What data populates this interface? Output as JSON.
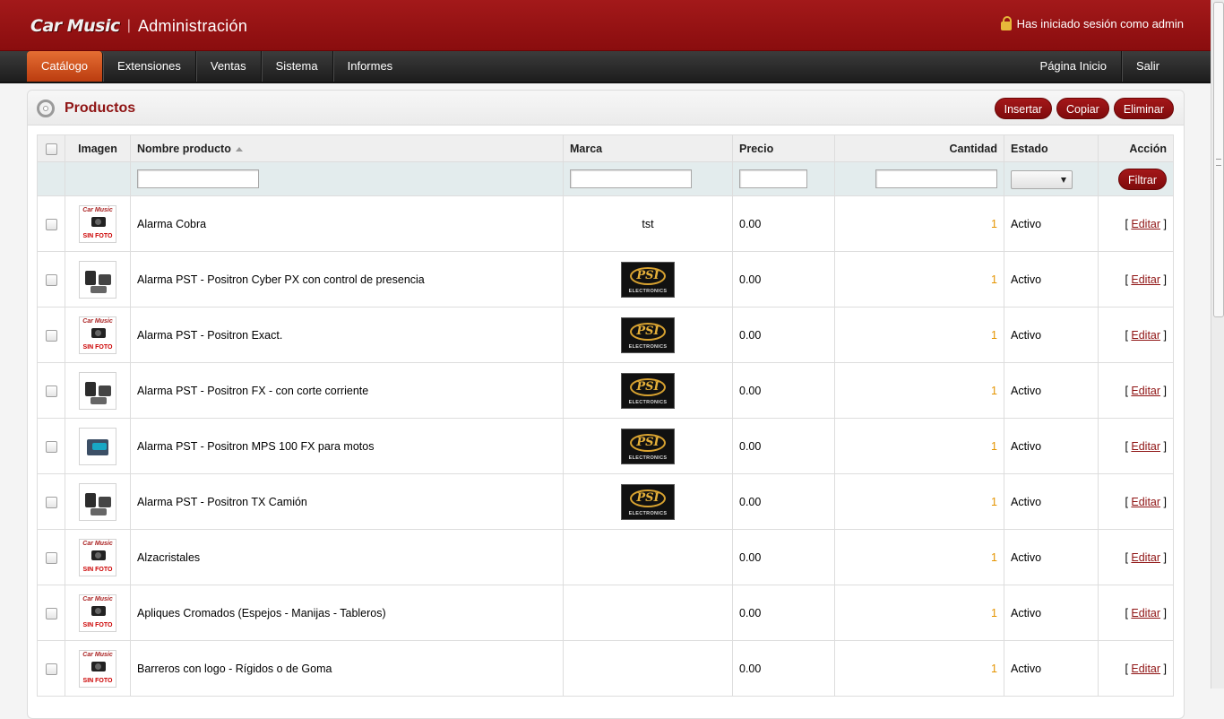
{
  "header": {
    "logo_text": "Car Music",
    "separator": "|",
    "title": "Administración",
    "login_text": "Has iniciado sesión como admin",
    "colors": {
      "header_bg": "#9a1314",
      "accent_orange": "#d85521",
      "title_red": "#8f1414"
    }
  },
  "menu": {
    "left": [
      "Catálogo",
      "Extensiones",
      "Ventas",
      "Sistema",
      "Informes"
    ],
    "active": "Catálogo",
    "right": [
      "Página Inicio",
      "Salir"
    ]
  },
  "panel": {
    "title": "Productos",
    "icon": "gear-icon",
    "buttons": {
      "insert": "Insertar",
      "copy": "Copiar",
      "delete": "Eliminar"
    }
  },
  "table": {
    "columns": {
      "image": "Imagen",
      "name": "Nombre producto",
      "brand": "Marca",
      "price": "Precio",
      "quantity": "Cantidad",
      "status": "Estado",
      "action": "Acción"
    },
    "filter": {
      "name": "",
      "brand": "",
      "price": "",
      "quantity": "",
      "status": "",
      "button": "Filtrar"
    },
    "rows": [
      {
        "image": "sin-foto",
        "name": "Alarma Cobra",
        "brand_text": "tst",
        "brand_logo": "",
        "price": "0.00",
        "quantity": "1",
        "status": "Activo",
        "action": "Editar"
      },
      {
        "image": "photo-remotes",
        "name": "Alarma PST - Positron Cyber PX con control de presencia",
        "brand_text": "",
        "brand_logo": "psi-electronics",
        "price": "0.00",
        "quantity": "1",
        "status": "Activo",
        "action": "Editar"
      },
      {
        "image": "sin-foto",
        "name": "Alarma PST - Positron Exact.",
        "brand_text": "",
        "brand_logo": "psi-electronics",
        "price": "0.00",
        "quantity": "1",
        "status": "Activo",
        "action": "Editar"
      },
      {
        "image": "photo-remotes",
        "name": "Alarma PST - Positron FX - con corte corriente",
        "brand_text": "",
        "brand_logo": "psi-electronics",
        "price": "0.00",
        "quantity": "1",
        "status": "Activo",
        "action": "Editar"
      },
      {
        "image": "photo-box",
        "name": "Alarma PST - Positron MPS 100 FX para motos",
        "brand_text": "",
        "brand_logo": "psi-electronics",
        "price": "0.00",
        "quantity": "1",
        "status": "Activo",
        "action": "Editar"
      },
      {
        "image": "photo-remotes",
        "name": "Alarma PST - Positron TX Camión",
        "brand_text": "",
        "brand_logo": "psi-electronics",
        "price": "0.00",
        "quantity": "1",
        "status": "Activo",
        "action": "Editar"
      },
      {
        "image": "sin-foto",
        "name": "Alzacristales",
        "brand_text": "",
        "brand_logo": "",
        "price": "0.00",
        "quantity": "1",
        "status": "Activo",
        "action": "Editar"
      },
      {
        "image": "sin-foto",
        "name": "Apliques Cromados (Espejos - Manijas - Tableros)",
        "brand_text": "",
        "brand_logo": "",
        "price": "0.00",
        "quantity": "1",
        "status": "Activo",
        "action": "Editar"
      },
      {
        "image": "sin-foto",
        "name": "Barreros con logo - Rígidos o de Goma",
        "brand_text": "",
        "brand_logo": "",
        "price": "0.00",
        "quantity": "1",
        "status": "Activo",
        "action": "Editar"
      }
    ],
    "placeholder_image": {
      "top": "Car Music",
      "bottom": "SIN FOTO"
    },
    "brand_logo_text": {
      "mark": "PSI",
      "sub": "ELECTRONICS"
    }
  }
}
